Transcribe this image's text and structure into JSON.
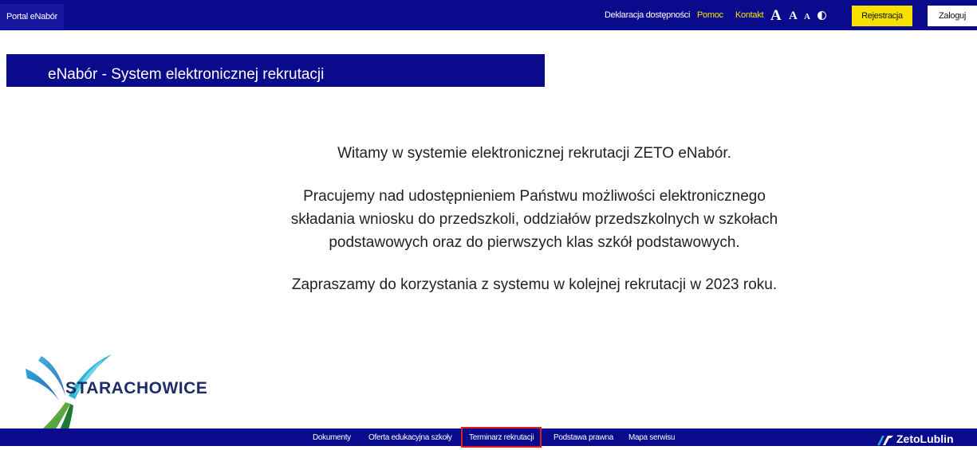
{
  "topbar": {
    "portal_tab": "Portal eNabór",
    "declaration_link": "Deklaracja dostępności",
    "help_link": "Pomoc",
    "contact_link": "Kontakt",
    "font_size_large": "A",
    "font_size_medium": "A",
    "font_size_small": "A",
    "register_button": "Rejestracja",
    "login_button": "Zaloguj"
  },
  "banner": {
    "title": "eNabór - System elektronicznej rekrutacji"
  },
  "main": {
    "welcome_line": "Witamy w systemie elektronicznej rekrutacji ZETO eNabór.",
    "info_line_1": "Pracujemy nad udostępnieniem Państwu możliwości elektronicznego",
    "info_line_2": "składania wniosku do przedszkoli, oddziałów przedszkolnych w szkołach",
    "info_line_3": "podstawowych oraz do pierwszych klas szkół podstawowych.",
    "invite_line": "Zapraszamy do korzystania z systemu w kolejnej rekrutacji w 2023 roku."
  },
  "logo": {
    "text": "STARACHOWICE"
  },
  "footer": {
    "links": [
      "Dokumenty",
      "Oferta edukacyjna szkoły",
      "Terminarz rekrutacji",
      "Podstawa prawna",
      "Mapa serwisu"
    ],
    "brand": "ZetoLublin"
  },
  "colors": {
    "primary_navy": "#0a0a8c",
    "accent_yellow": "#f8e100",
    "highlight_red": "#e01e1e"
  }
}
